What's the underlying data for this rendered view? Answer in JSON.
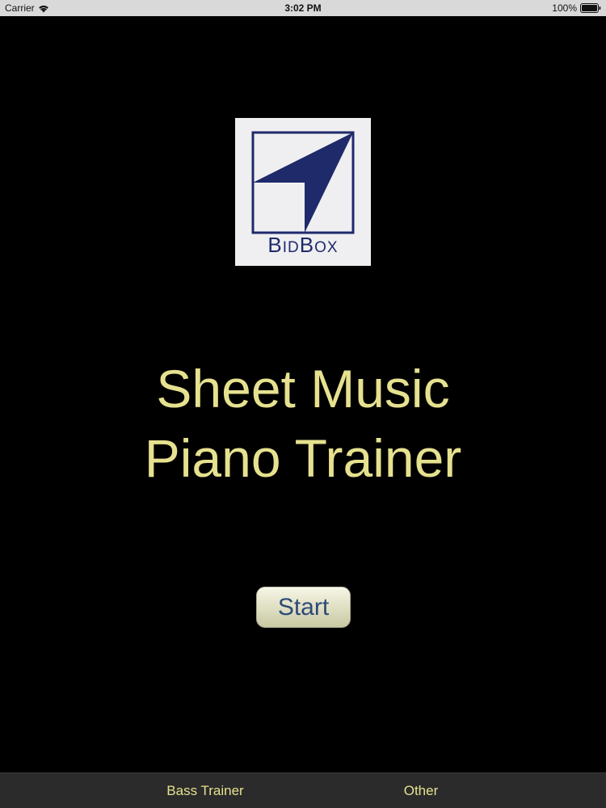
{
  "status_bar": {
    "carrier": "Carrier",
    "time": "3:02 PM",
    "battery": "100%",
    "icons": [
      "wifi-icon",
      "battery-icon"
    ]
  },
  "logo": {
    "brand_text": "BidBox",
    "colors": {
      "navy": "#1f2a6b",
      "background": "#efeff1"
    }
  },
  "main": {
    "title_line1": "Sheet Music",
    "title_line2": "Piano Trainer",
    "start_label": "Start"
  },
  "tab_bar": {
    "items": [
      {
        "label": "Bass Trainer"
      },
      {
        "label": "Other"
      }
    ]
  },
  "colors": {
    "accent_text": "#e6e18f",
    "button_text": "#2d4a78",
    "background": "#000000",
    "tab_bar": "#2b2b2b"
  }
}
